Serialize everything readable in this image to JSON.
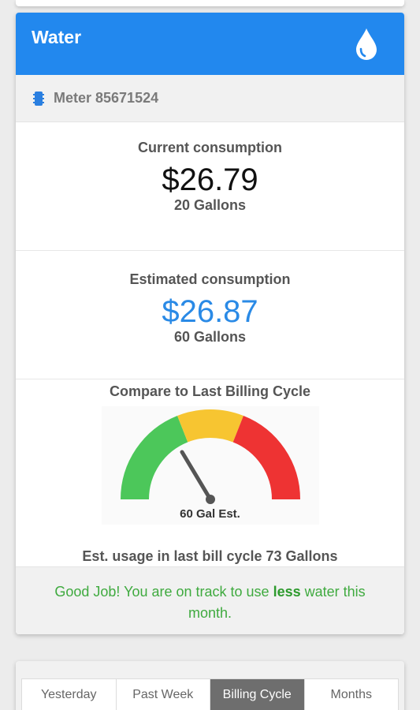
{
  "card": {
    "title": "Water",
    "header_color": "#2288ee",
    "icon": "water-drop-icon"
  },
  "meter": {
    "icon": "meter-icon",
    "label": "Meter 85671524"
  },
  "current": {
    "title": "Current consumption",
    "amount": "$26.79",
    "gallons": "20 Gallons"
  },
  "estimated": {
    "title": "Estimated consumption",
    "amount": "$26.87",
    "gallons": "60 Gallons",
    "amount_color": "#2a8ae6"
  },
  "compare": {
    "title": "Compare to Last Billing Cycle",
    "gauge_label": "60 Gal Est.",
    "gauge_fraction": 0.2,
    "gauge_colors": [
      "#4cc75a",
      "#f7c531",
      "#ee3333"
    ],
    "usage_text": "Est. usage in last bill cycle 73 Gallons"
  },
  "message": {
    "before": "Good Job! You are on track to use ",
    "bold": "less",
    "after": " water this month."
  },
  "tabs": {
    "items": [
      "Yesterday",
      "Past Week",
      "Billing Cycle",
      "Months"
    ],
    "active": "Billing Cycle"
  }
}
